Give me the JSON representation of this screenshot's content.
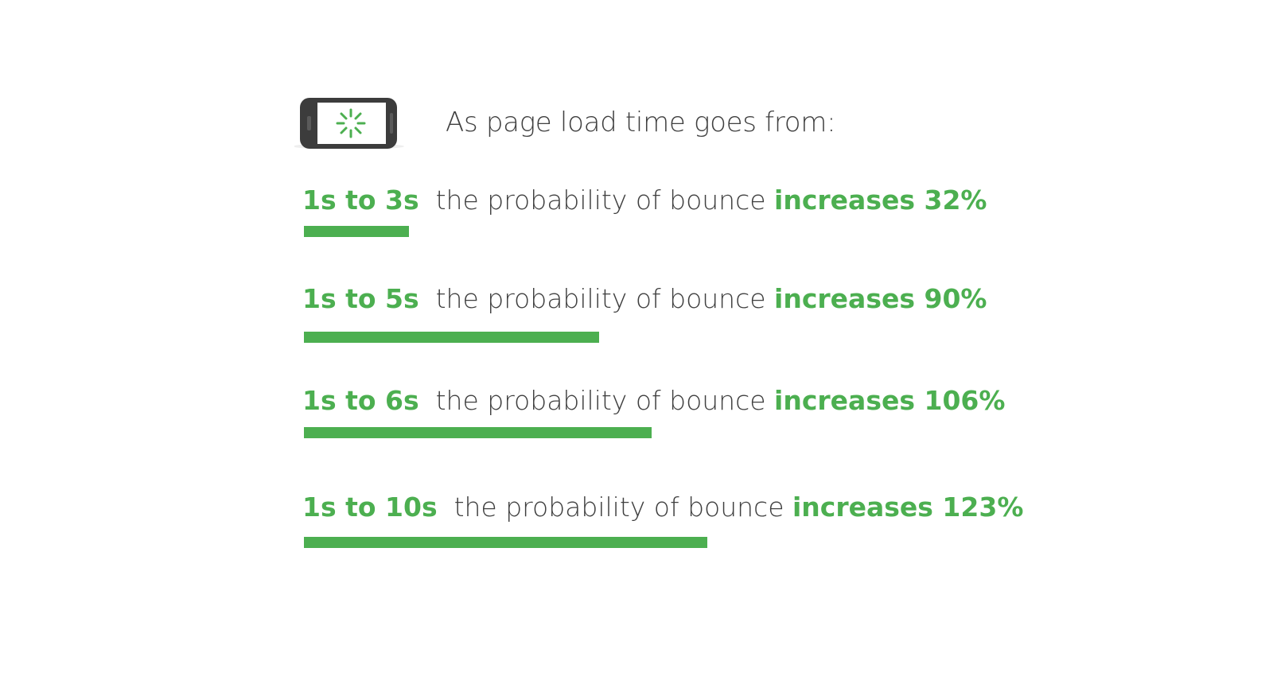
{
  "header": {
    "icon": "phone-loading-icon",
    "text": "As page load time goes from:"
  },
  "colors": {
    "accent": "#4caf50",
    "text": "#3f3f3f",
    "phone_body": "#3c3c3c"
  },
  "chart_data": {
    "type": "bar",
    "orientation": "horizontal",
    "categories": [
      "1s to 3s",
      "1s to 5s",
      "1s to 6s",
      "1s to 10s"
    ],
    "values": [
      32,
      90,
      106,
      123
    ],
    "unit": "%",
    "middle_text": "the probability of bounce",
    "prefix_text": "increases",
    "value_labels": [
      "32%",
      "90%",
      "106%",
      "123%"
    ],
    "grid": false,
    "legend": "none"
  }
}
